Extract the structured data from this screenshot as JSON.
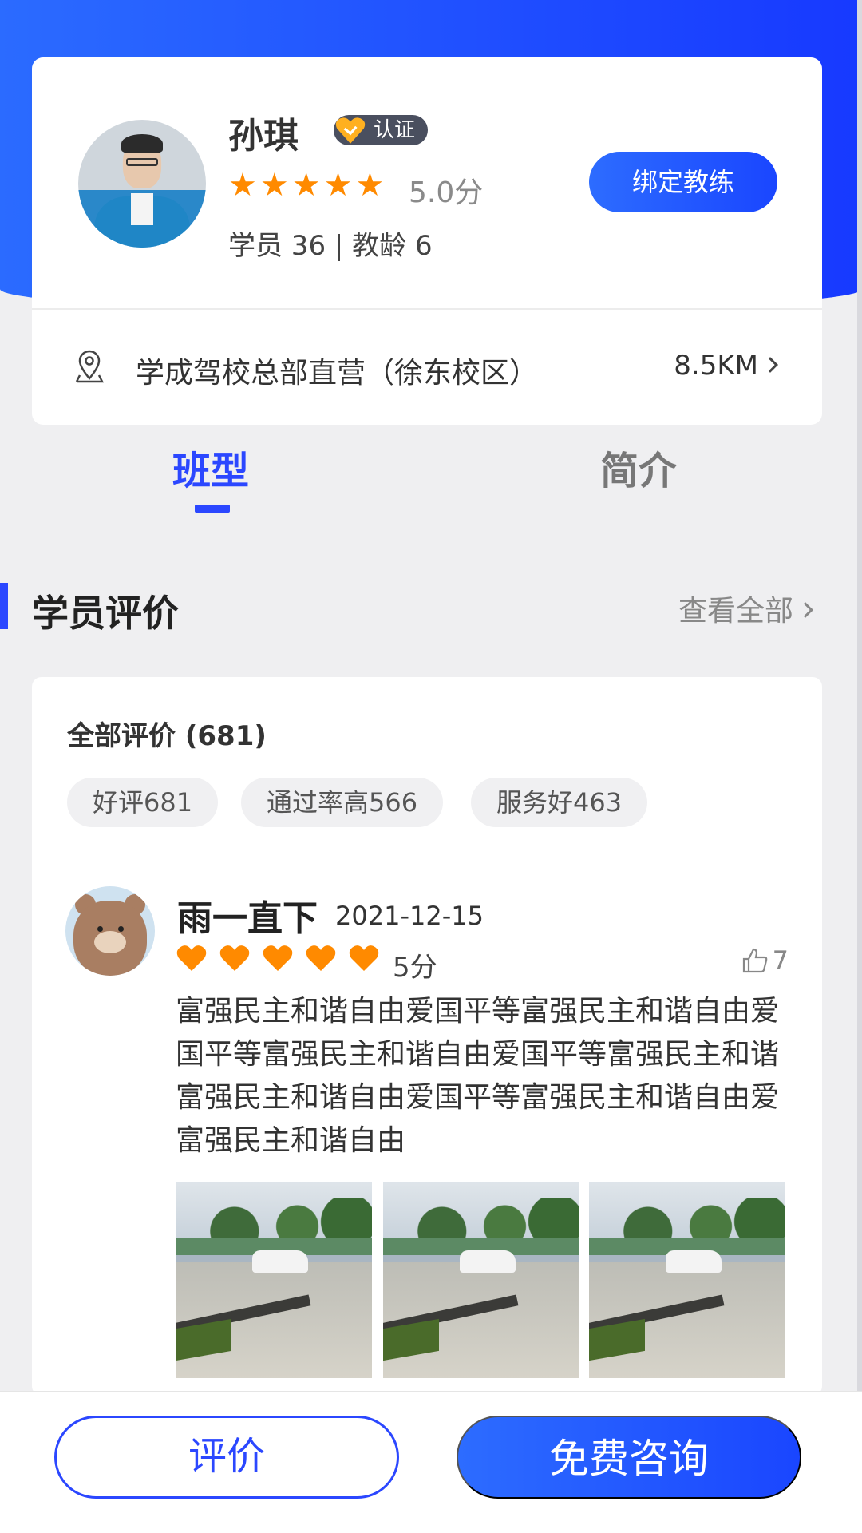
{
  "coach": {
    "name": "孙琪",
    "badge": "认证",
    "rating_stars": 5,
    "score": "5.0分",
    "stats": "学员 36 | 教龄 6",
    "bind_button": "绑定教练",
    "address": "学成驾校总部直营（徐东校区）",
    "distance": "8.5KM"
  },
  "tabs": [
    {
      "label": "班型",
      "active": true
    },
    {
      "label": "简介",
      "active": false
    }
  ],
  "reviews_section": {
    "title": "学员评价",
    "view_all": "查看全部"
  },
  "review_summary": {
    "title": "全部评价 (681)",
    "tags": [
      "好评681",
      "通过率高566",
      "服务好463"
    ]
  },
  "review": {
    "name": "雨一直下",
    "date": "2021-12-15",
    "hearts": 5,
    "score": "5分",
    "likes": "7",
    "text": "富强民主和谐自由爱国平等富强民主和谐自由爱国平等富强民主和谐自由爱国平等富强民主和谐富强民主和谐自由爱国平等富强民主和谐自由爱富强民主和谐自由",
    "photos": 3
  },
  "bottom_bar": {
    "review_button": "评价",
    "consult_button": "免费咨询"
  },
  "colors": {
    "primary": "#2b47ff",
    "star": "#ff8a00"
  }
}
